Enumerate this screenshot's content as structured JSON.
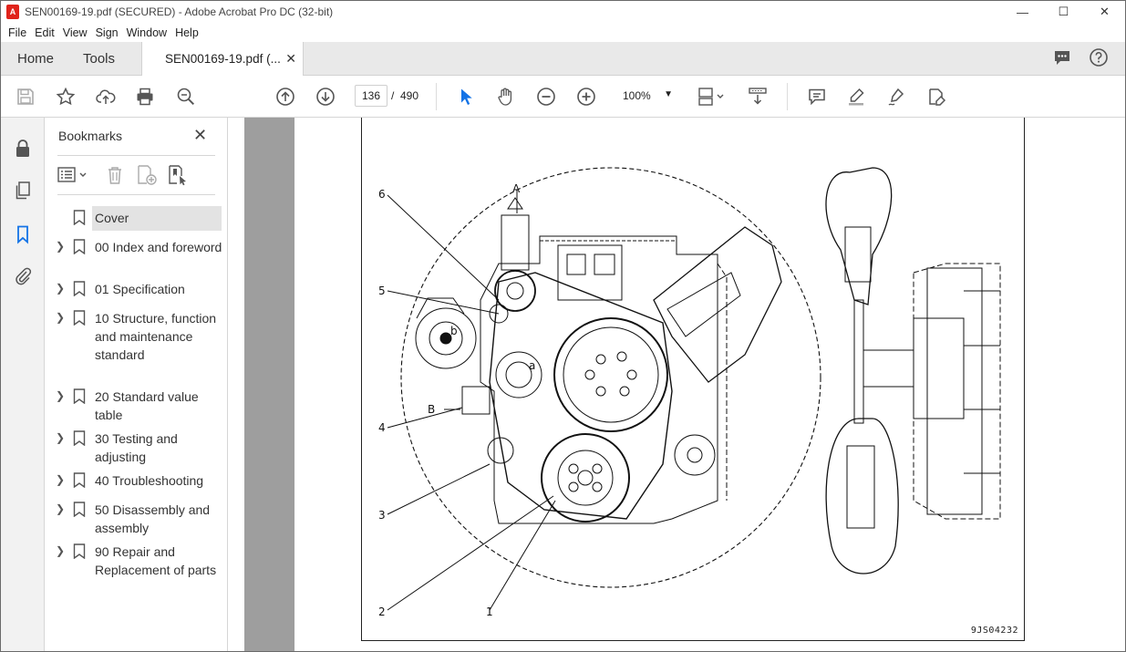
{
  "window": {
    "title": "SEN00169-19.pdf (SECURED) - Adobe Acrobat Pro DC (32-bit)",
    "minimize": "—",
    "maximize": "☐",
    "close": "✕"
  },
  "menu": [
    "File",
    "Edit",
    "View",
    "Sign",
    "Window",
    "Help"
  ],
  "tabs": {
    "home": "Home",
    "tools": "Tools",
    "document": "SEN00169-19.pdf (...",
    "close": "✕"
  },
  "toolbar": {
    "current_page": "136",
    "page_separator": "/",
    "total_pages": "490",
    "zoom": "100%"
  },
  "bookmarks_panel": {
    "title": "Bookmarks",
    "close": "✕",
    "items": [
      {
        "label": "Cover",
        "expandable": false,
        "selected": true
      },
      {
        "label": "00 Index and foreword",
        "expandable": true
      },
      {
        "label": "01 Specification",
        "expandable": true
      },
      {
        "label": "10 Structure, function and maintenance standard",
        "expandable": true
      },
      {
        "label": "20 Standard value table",
        "expandable": true
      },
      {
        "label": "30 Testing and adjusting",
        "expandable": true
      },
      {
        "label": "40 Troubleshooting",
        "expandable": true
      },
      {
        "label": "50 Disassembly and assembly",
        "expandable": true
      },
      {
        "label": "90 Repair and Replacement of parts",
        "expandable": true
      }
    ]
  },
  "document": {
    "figure_id": "9JS04232",
    "callouts": [
      "6",
      "5",
      "4",
      "3",
      "2",
      "1"
    ],
    "view_labels": {
      "a": "A",
      "b": "B",
      "dim_a": "a",
      "dim_b": "b"
    }
  },
  "colors": {
    "acrobat_red": "#e0231b",
    "panel_bg": "#f2f2f2",
    "tabbar_bg": "#e9e9e9",
    "page_gutter": "#9e9e9e",
    "selected_bookmark": "#e3e3e3",
    "cursor_blue": "#1473e6"
  }
}
